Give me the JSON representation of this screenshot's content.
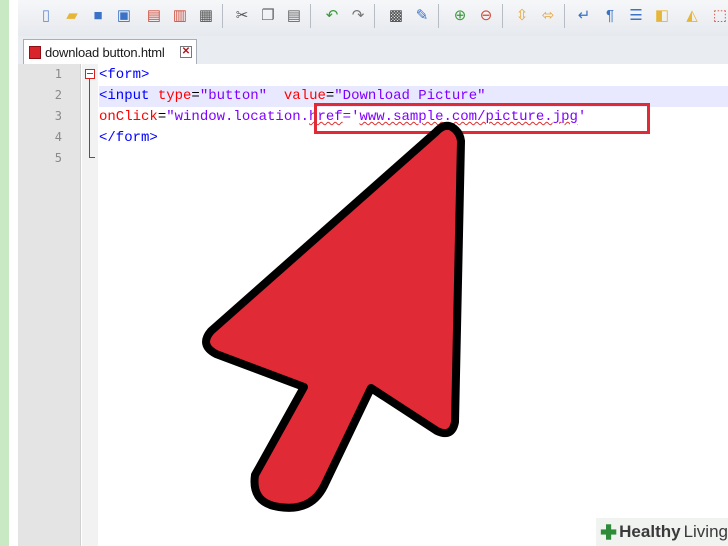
{
  "toolbar": {
    "icons": [
      "new-file-icon",
      "open-folder-icon",
      "save-icon",
      "save-all-icon",
      "close-icon",
      "close-all-icon",
      "print-icon",
      "cut-icon",
      "copy-icon",
      "paste-icon",
      "undo-icon",
      "redo-icon",
      "find-icon",
      "replace-icon",
      "zoom-in-icon",
      "zoom-out-icon",
      "sync-vertical-icon",
      "sync-horizontal-icon",
      "word-wrap-icon",
      "show-all-chars-icon",
      "indent-guide-icon",
      "user-language-icon",
      "macro-record-icon",
      "macro-stop-icon"
    ]
  },
  "tab": {
    "label": "download button.html",
    "close_label": "✕"
  },
  "editor": {
    "line_numbers": [
      "1",
      "2",
      "3",
      "4",
      "5"
    ],
    "lines": [
      [
        "<form>"
      ],
      [
        "<input ",
        "type",
        "=",
        "\"button\"",
        "  ",
        "value",
        "=",
        "\"Download Picture\""
      ],
      [
        "onClick",
        "=",
        "\"window.location.",
        "href",
        "=",
        "'",
        "www.sample.com/picture.jpg",
        "'"
      ],
      [
        "</form>"
      ],
      [
        ""
      ]
    ]
  },
  "watermark": {
    "brand": "Healthy",
    "brand2": "Living"
  },
  "colors": {
    "arrow": "#e02a36",
    "tag": "#0000ff",
    "attribute": "#ff0000",
    "value": "#8000ff"
  }
}
